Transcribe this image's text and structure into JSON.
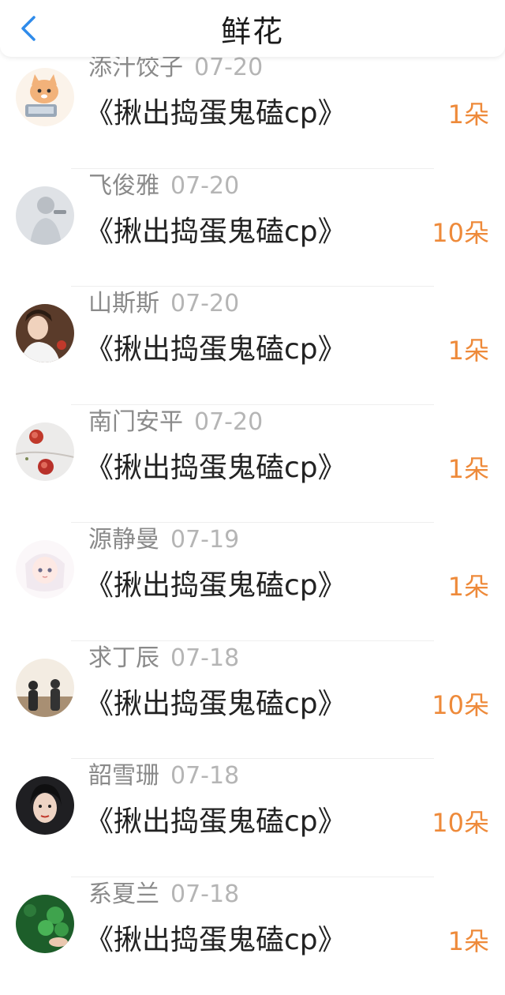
{
  "header": {
    "title": "鲜花",
    "back_icon": "chevron-left-icon"
  },
  "colors": {
    "accent": "#2f8bea",
    "count": "#ee8a3a",
    "meta": "#8a8a8a",
    "date": "#b5b5b5"
  },
  "rows": [
    {
      "name": "添汁饺子",
      "date": "07-20",
      "book": "《揪出捣蛋鬼磕cp》",
      "count": "1朵"
    },
    {
      "name": "飞俊雅",
      "date": "07-20",
      "book": "《揪出捣蛋鬼磕cp》",
      "count": "10朵"
    },
    {
      "name": "山斯斯",
      "date": "07-20",
      "book": "《揪出捣蛋鬼磕cp》",
      "count": "1朵"
    },
    {
      "name": "南门安平",
      "date": "07-20",
      "book": "《揪出捣蛋鬼磕cp》",
      "count": "1朵"
    },
    {
      "name": "源静曼",
      "date": "07-19",
      "book": "《揪出捣蛋鬼磕cp》",
      "count": "1朵"
    },
    {
      "name": "求丁辰",
      "date": "07-18",
      "book": "《揪出捣蛋鬼磕cp》",
      "count": "10朵"
    },
    {
      "name": "韶雪珊",
      "date": "07-18",
      "book": "《揪出捣蛋鬼磕cp》",
      "count": "10朵"
    },
    {
      "name": "系夏兰",
      "date": "07-18",
      "book": "《揪出捣蛋鬼磕cp》",
      "count": "1朵"
    }
  ]
}
